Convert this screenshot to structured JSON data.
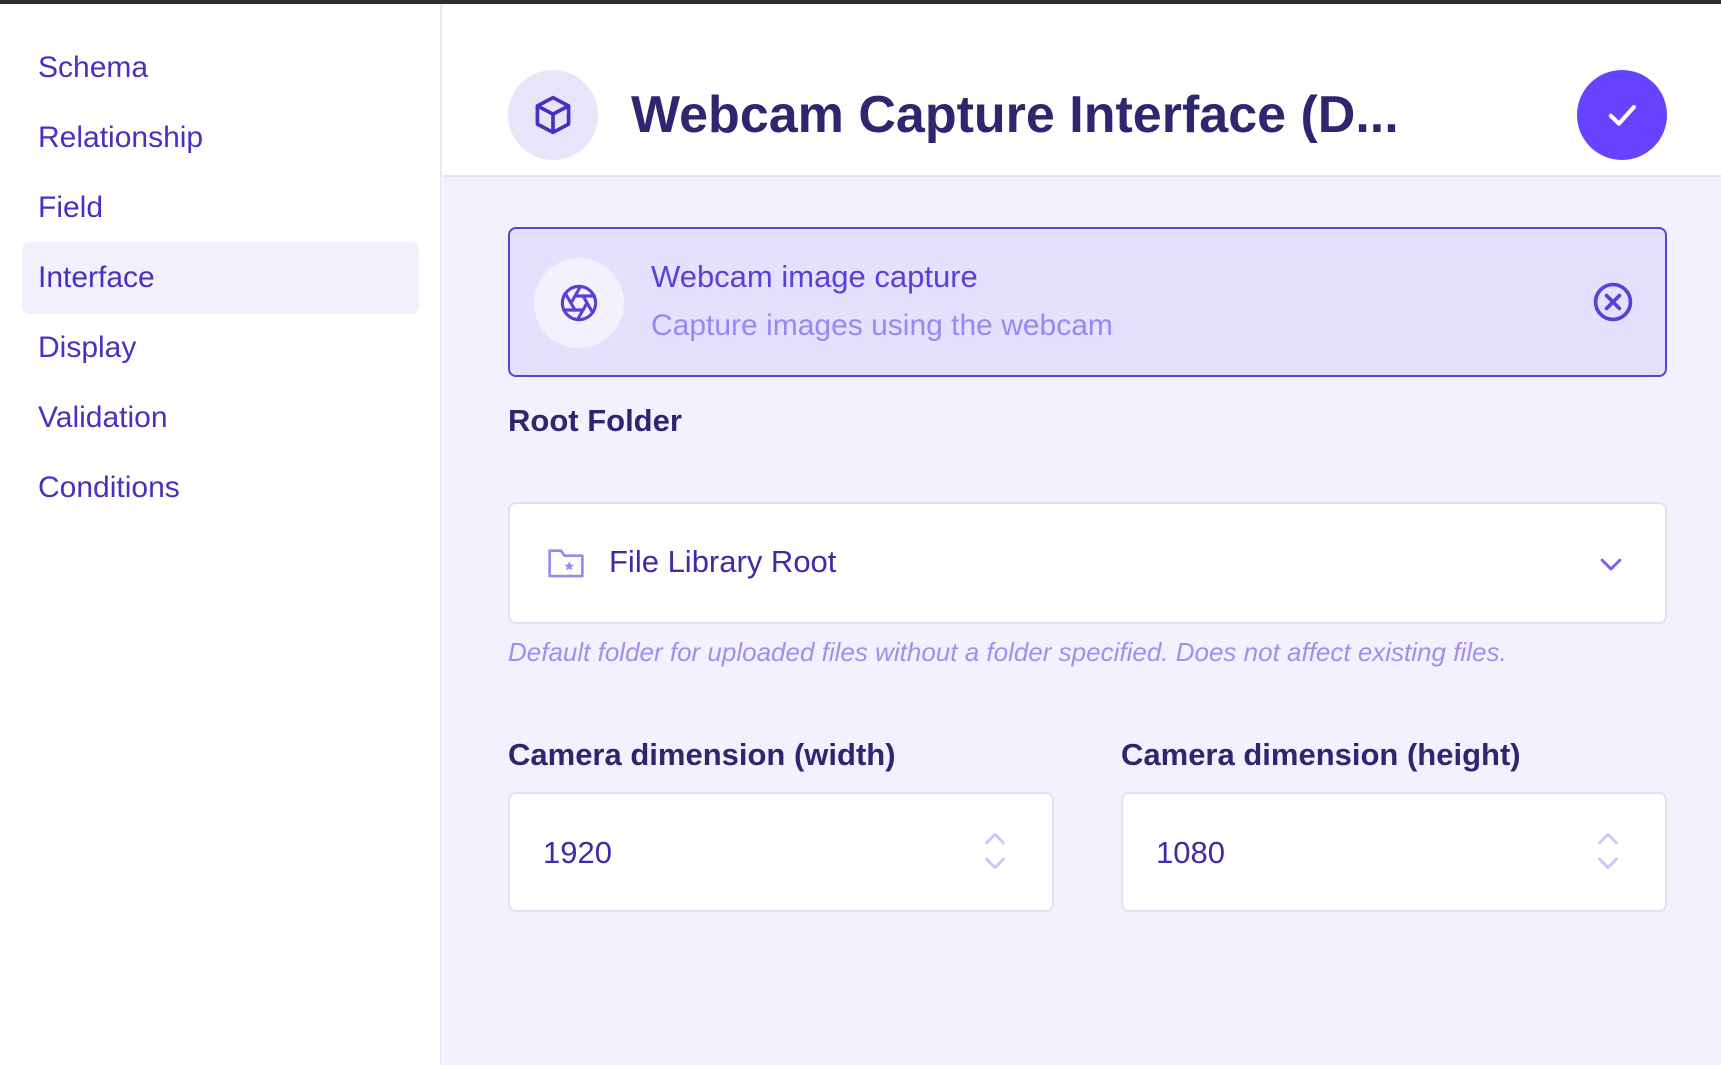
{
  "sidebar": {
    "items": [
      {
        "label": "Schema"
      },
      {
        "label": "Relationship"
      },
      {
        "label": "Field"
      },
      {
        "label": "Interface",
        "active": true
      },
      {
        "label": "Display"
      },
      {
        "label": "Validation"
      },
      {
        "label": "Conditions"
      }
    ]
  },
  "header": {
    "icon": "box-icon",
    "title": "Webcam Capture Interface (D...",
    "confirm_icon": "check-icon"
  },
  "interface_card": {
    "icon": "aperture-icon",
    "name": "Webcam image capture",
    "description": "Capture images using the webcam",
    "close_icon": "close-circle-icon"
  },
  "root_folder": {
    "label": "Root Folder",
    "icon": "folder-star-icon",
    "value": "File Library Root",
    "hint": "Default folder for uploaded files without a folder specified. Does not affect existing files."
  },
  "camera_width": {
    "label": "Camera dimension (width)",
    "value": "1920"
  },
  "camera_height": {
    "label": "Camera dimension (height)",
    "value": "1080"
  },
  "colors": {
    "accent": "#6644ff",
    "text_primary": "#2f2670",
    "sidebar_text": "#4b2fc0",
    "main_background": "#f3f1fd",
    "card_background": "#e4e0fd"
  }
}
